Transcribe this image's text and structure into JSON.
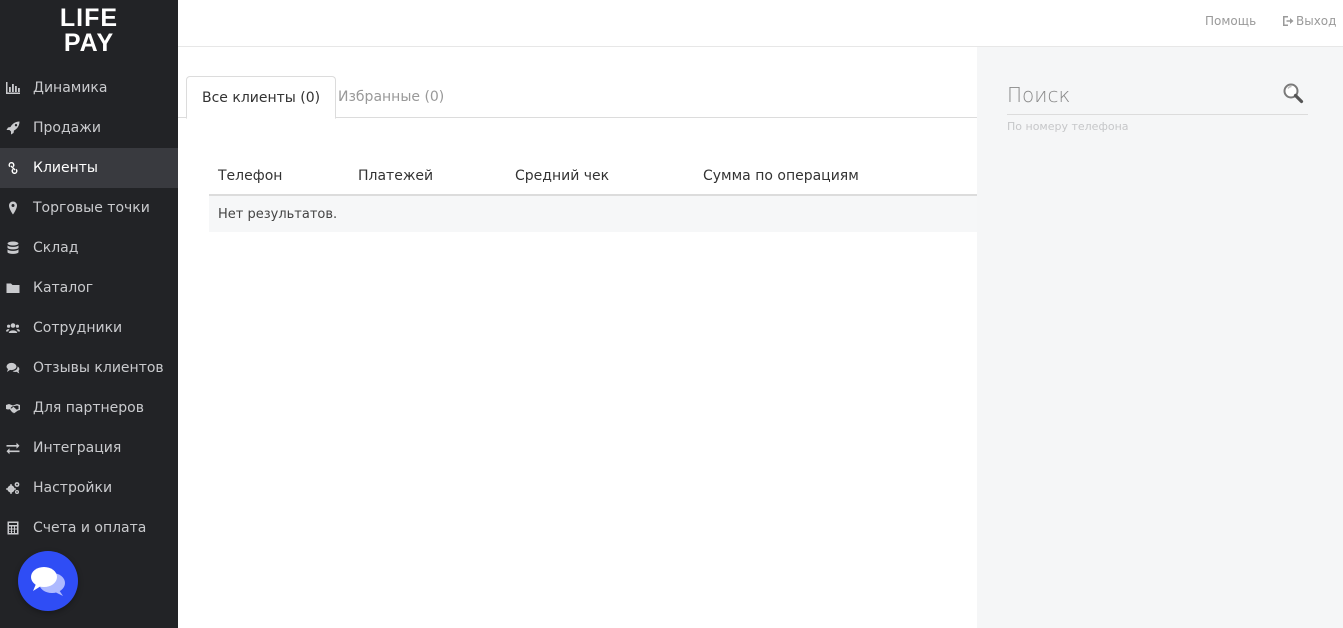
{
  "logo": {
    "line1": "LIFE",
    "line2": "PAY"
  },
  "sidebar": {
    "items": [
      {
        "label": "Динамика",
        "icon": "bar-chart-icon",
        "active": false
      },
      {
        "label": "Продажи",
        "icon": "rocket-icon",
        "active": false
      },
      {
        "label": "Клиенты",
        "icon": "link-icon",
        "active": true
      },
      {
        "label": "Торговые точки",
        "icon": "map-pin-icon",
        "active": false
      },
      {
        "label": "Склад",
        "icon": "database-icon",
        "active": false
      },
      {
        "label": "Каталог",
        "icon": "folder-icon",
        "active": false
      },
      {
        "label": "Сотрудники",
        "icon": "users-icon",
        "active": false
      },
      {
        "label": "Отзывы клиентов",
        "icon": "comments-icon",
        "active": false
      },
      {
        "label": "Для партнеров",
        "icon": "handshake-icon",
        "active": false
      },
      {
        "label": "Интеграция",
        "icon": "exchange-icon",
        "active": false
      },
      {
        "label": "Настройки",
        "icon": "gears-icon",
        "active": false
      },
      {
        "label": "Счета и оплата",
        "icon": "calculator-icon",
        "active": false
      }
    ]
  },
  "header": {
    "help": "Помощь",
    "logout": "Выход"
  },
  "tabs": [
    {
      "label": "Все клиенты (0)",
      "active": true
    },
    {
      "label": "Избранные (0)",
      "active": false
    }
  ],
  "table": {
    "columns": [
      "Телефон",
      "Платежей",
      "Средний чек",
      "Сумма по операциям"
    ],
    "empty_text": "Нет результатов."
  },
  "search": {
    "placeholder": "Поиск",
    "hint": "По номеру телефона"
  },
  "colors": {
    "sidebar_bg": "#222326",
    "sidebar_active": "#393a3f",
    "chat_button": "#2f4df5",
    "right_panel_bg": "#f5f6f7"
  }
}
